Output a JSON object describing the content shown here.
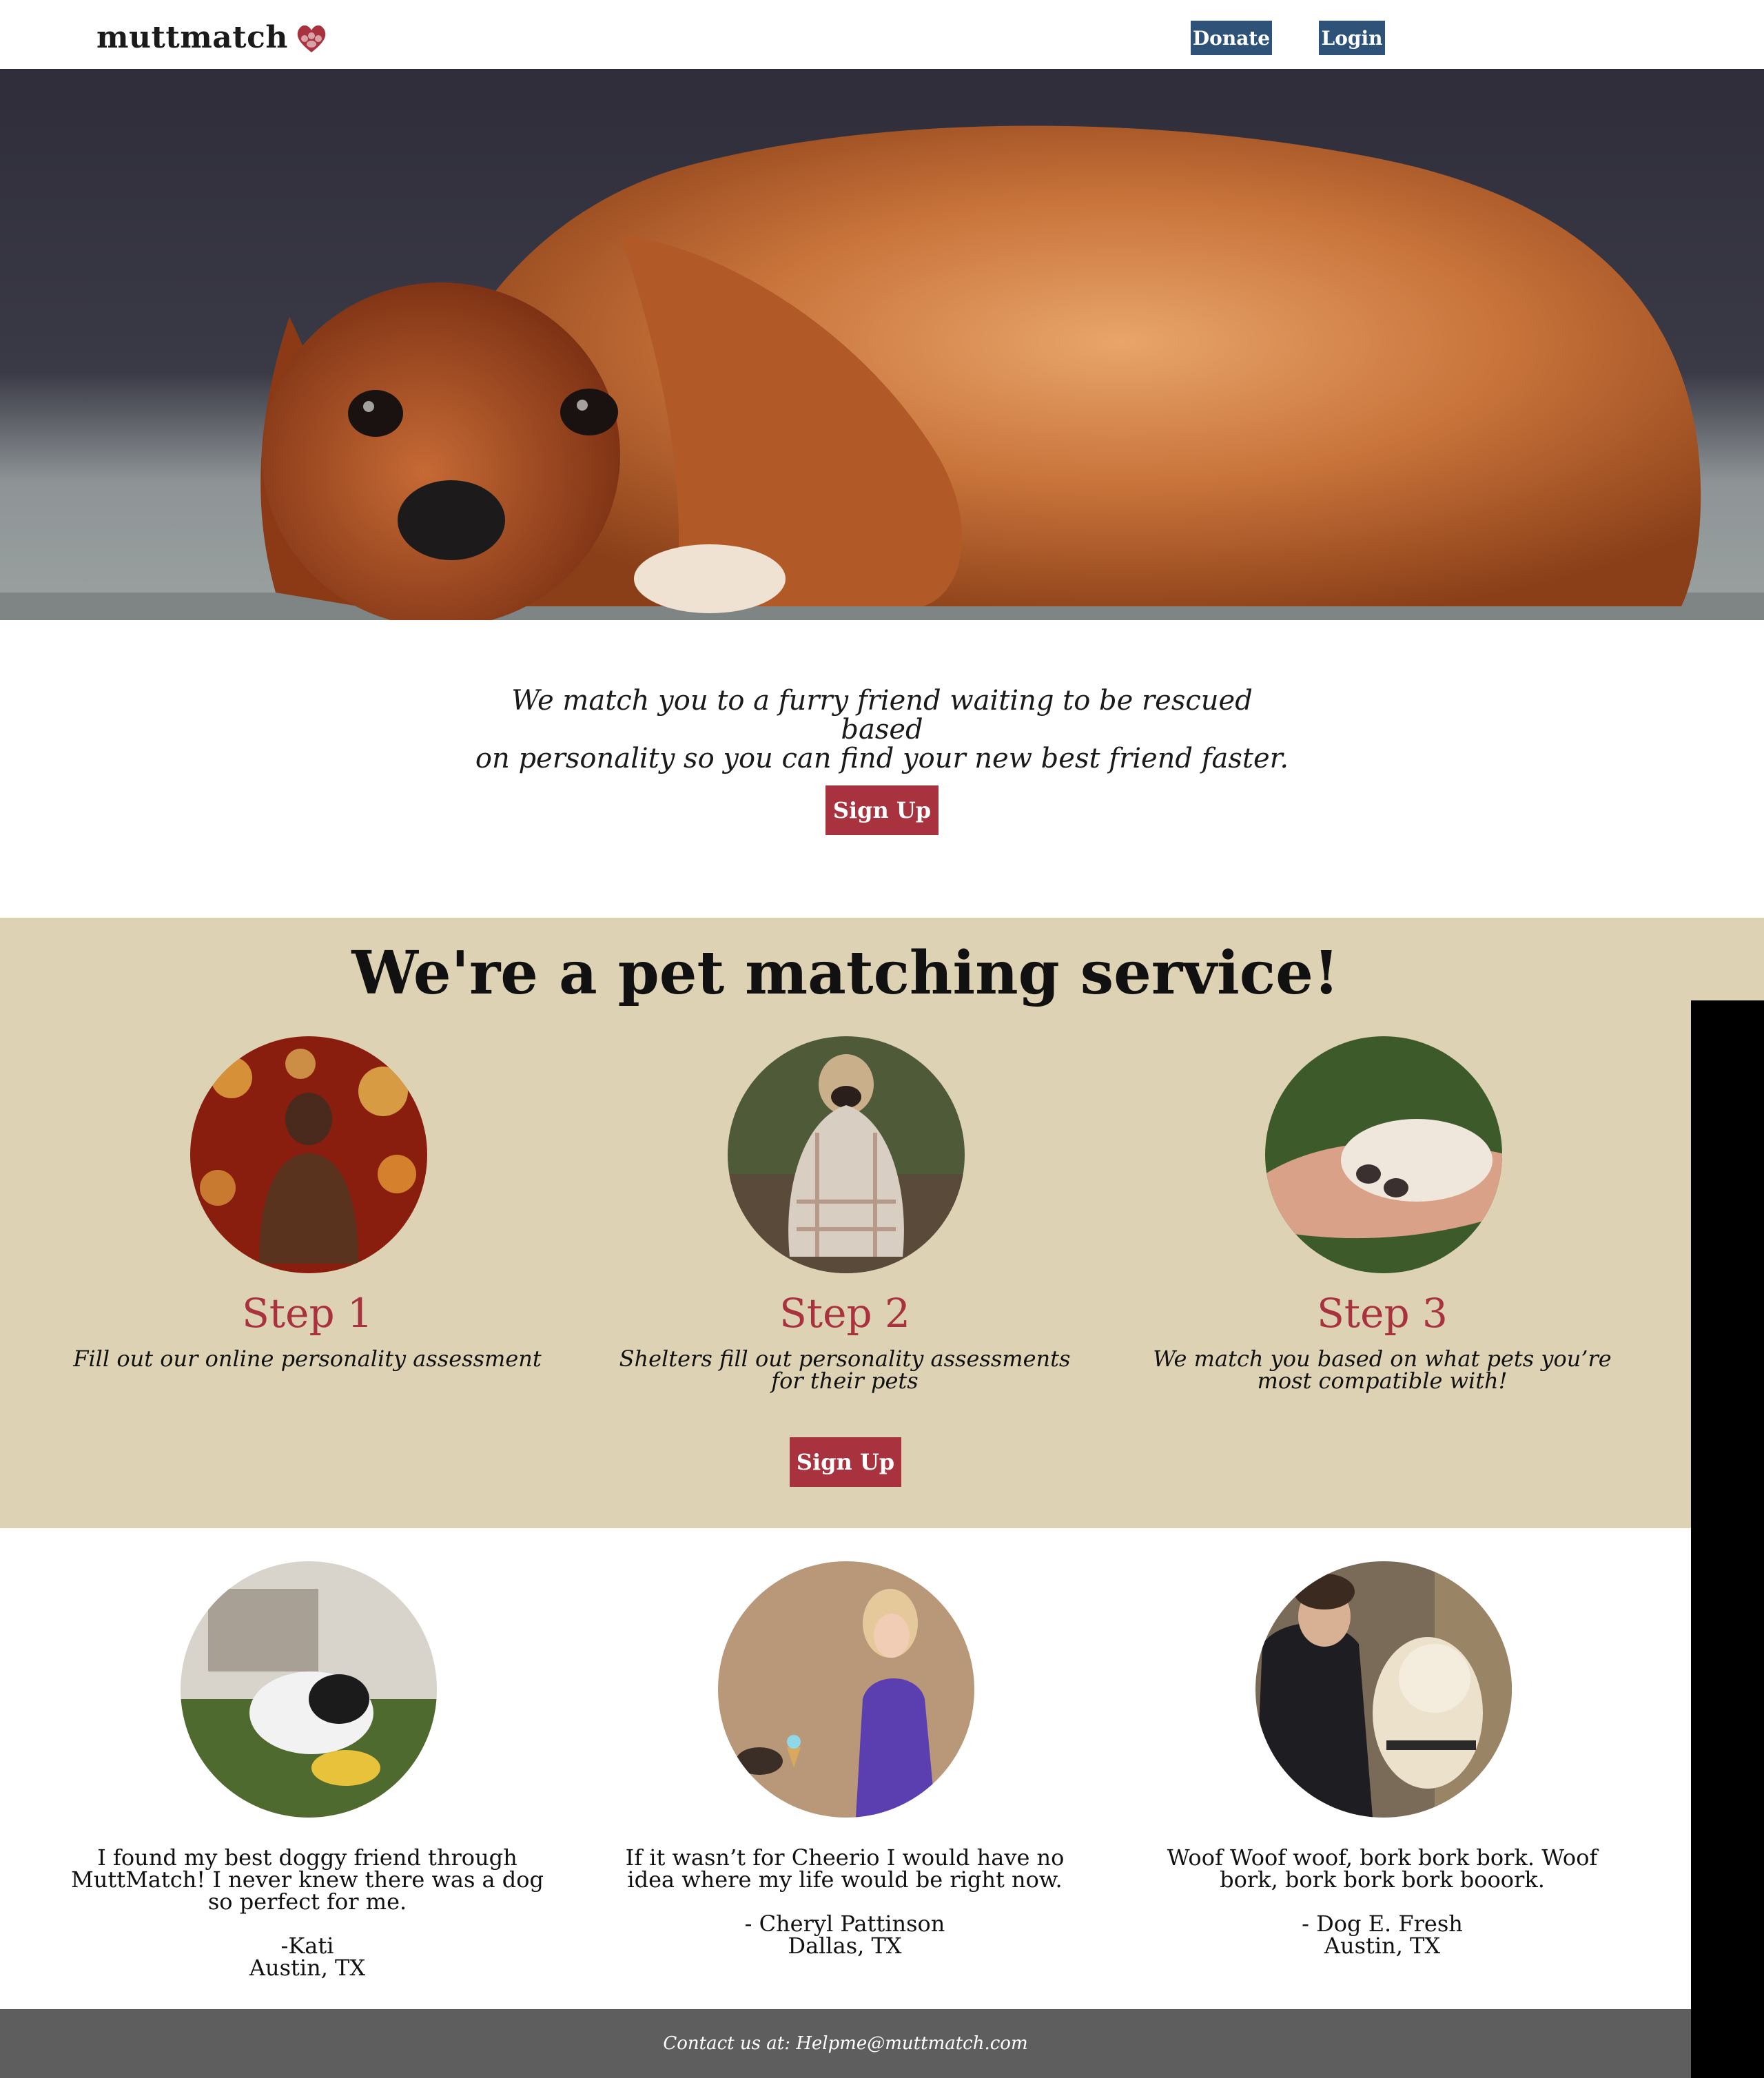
{
  "header": {
    "logo_text": "muttmatch",
    "nav": {
      "donate_label": "Donate",
      "login_label": "Login"
    }
  },
  "intro": {
    "line1": "We match you to a furry friend waiting to be rescued based",
    "line2": "on personality so you can find your new best friend faster.",
    "signup_label": "Sign Up"
  },
  "steps": {
    "title": "We're a pet matching service!",
    "items": [
      {
        "title": "Step 1",
        "desc": "Fill out our online personality assessment",
        "image": "buddha-statue-bokeh"
      },
      {
        "title": "Step 2",
        "desc": "Shelters fill out personality assessments for their pets",
        "image": "pug-in-blanket"
      },
      {
        "title": "Step 3",
        "desc": "We match you based on what pets you’re most compatible with!",
        "image": "hand-holding-paw"
      }
    ],
    "signup_label": "Sign Up"
  },
  "testimonials": [
    {
      "quote": "I found my best doggy friend through MuttMatch! I never knew there was a dog so perfect for me.",
      "name": "-Kati",
      "location": "Austin, TX",
      "image": "puppy-with-toy"
    },
    {
      "quote": "If it wasn’t for Cheerio I would have no idea where my life would be right now.",
      "name": "- Cheryl Pattinson",
      "location": "Dallas, TX",
      "image": "woman-with-ice-cream-dog"
    },
    {
      "quote": "Woof Woof woof, bork bork bork. Woof bork, bork bork bork booork.",
      "name": "- Dog E. Fresh",
      "location": "Austin, TX",
      "image": "man-with-golden-retriever"
    }
  ],
  "footer": {
    "text": "Contact us at: Helpme@muttmatch.com"
  },
  "colors": {
    "accent_red": "#a8323e",
    "nav_blue": "#2f5279",
    "tan": "#ddd2b4",
    "footer_gray": "#5e5e5e"
  },
  "icons": {
    "logo": "paw-heart-icon"
  },
  "hero": {
    "image": "cavalier-spaniel-lying-down"
  }
}
